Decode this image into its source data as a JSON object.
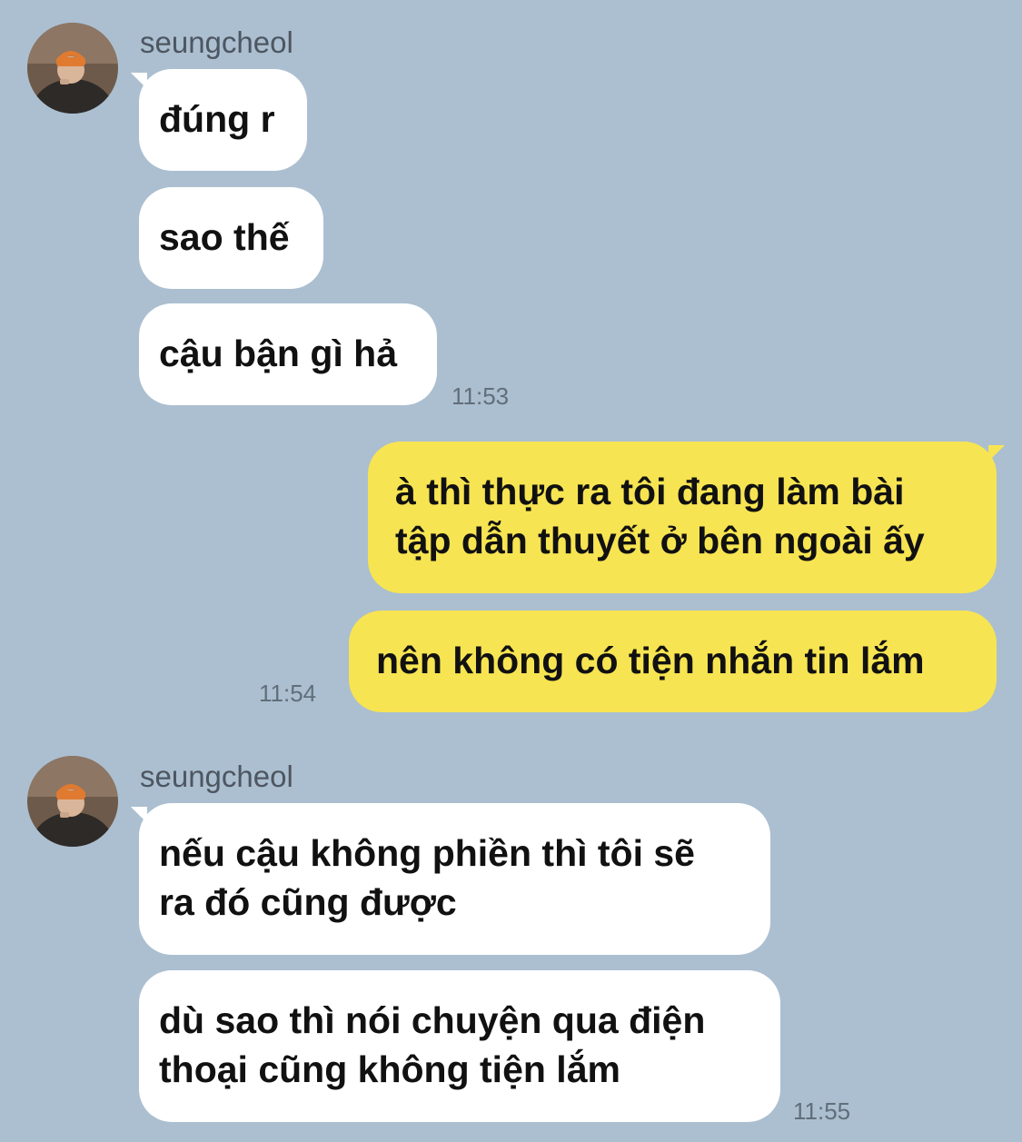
{
  "colors": {
    "background": "#abbfd0",
    "incoming_bubble": "#ffffff",
    "outgoing_bubble": "#f7e452",
    "timestamp": "#626e7a",
    "sender_name": "#4d5661"
  },
  "groups": [
    {
      "sender": "seungcheol",
      "avatar_icon": "profile-photo-avatar",
      "messages": [
        "đúng r",
        "sao thế",
        "cậu bận gì hả"
      ],
      "time": "11:53"
    },
    {
      "sender": "me",
      "messages": [
        "à thì thực ra tôi đang làm bài\ntập dẫn thuyết ở bên ngoài ấy",
        "nên không có tiện nhắn tin lắm"
      ],
      "time": "11:54"
    },
    {
      "sender": "seungcheol",
      "avatar_icon": "profile-photo-avatar",
      "messages": [
        "nếu cậu không phiền thì tôi sẽ\nra đó cũng được",
        "dù sao thì nói chuyện qua điện\nthoại cũng không tiện lắm"
      ],
      "time": "11:55"
    }
  ]
}
